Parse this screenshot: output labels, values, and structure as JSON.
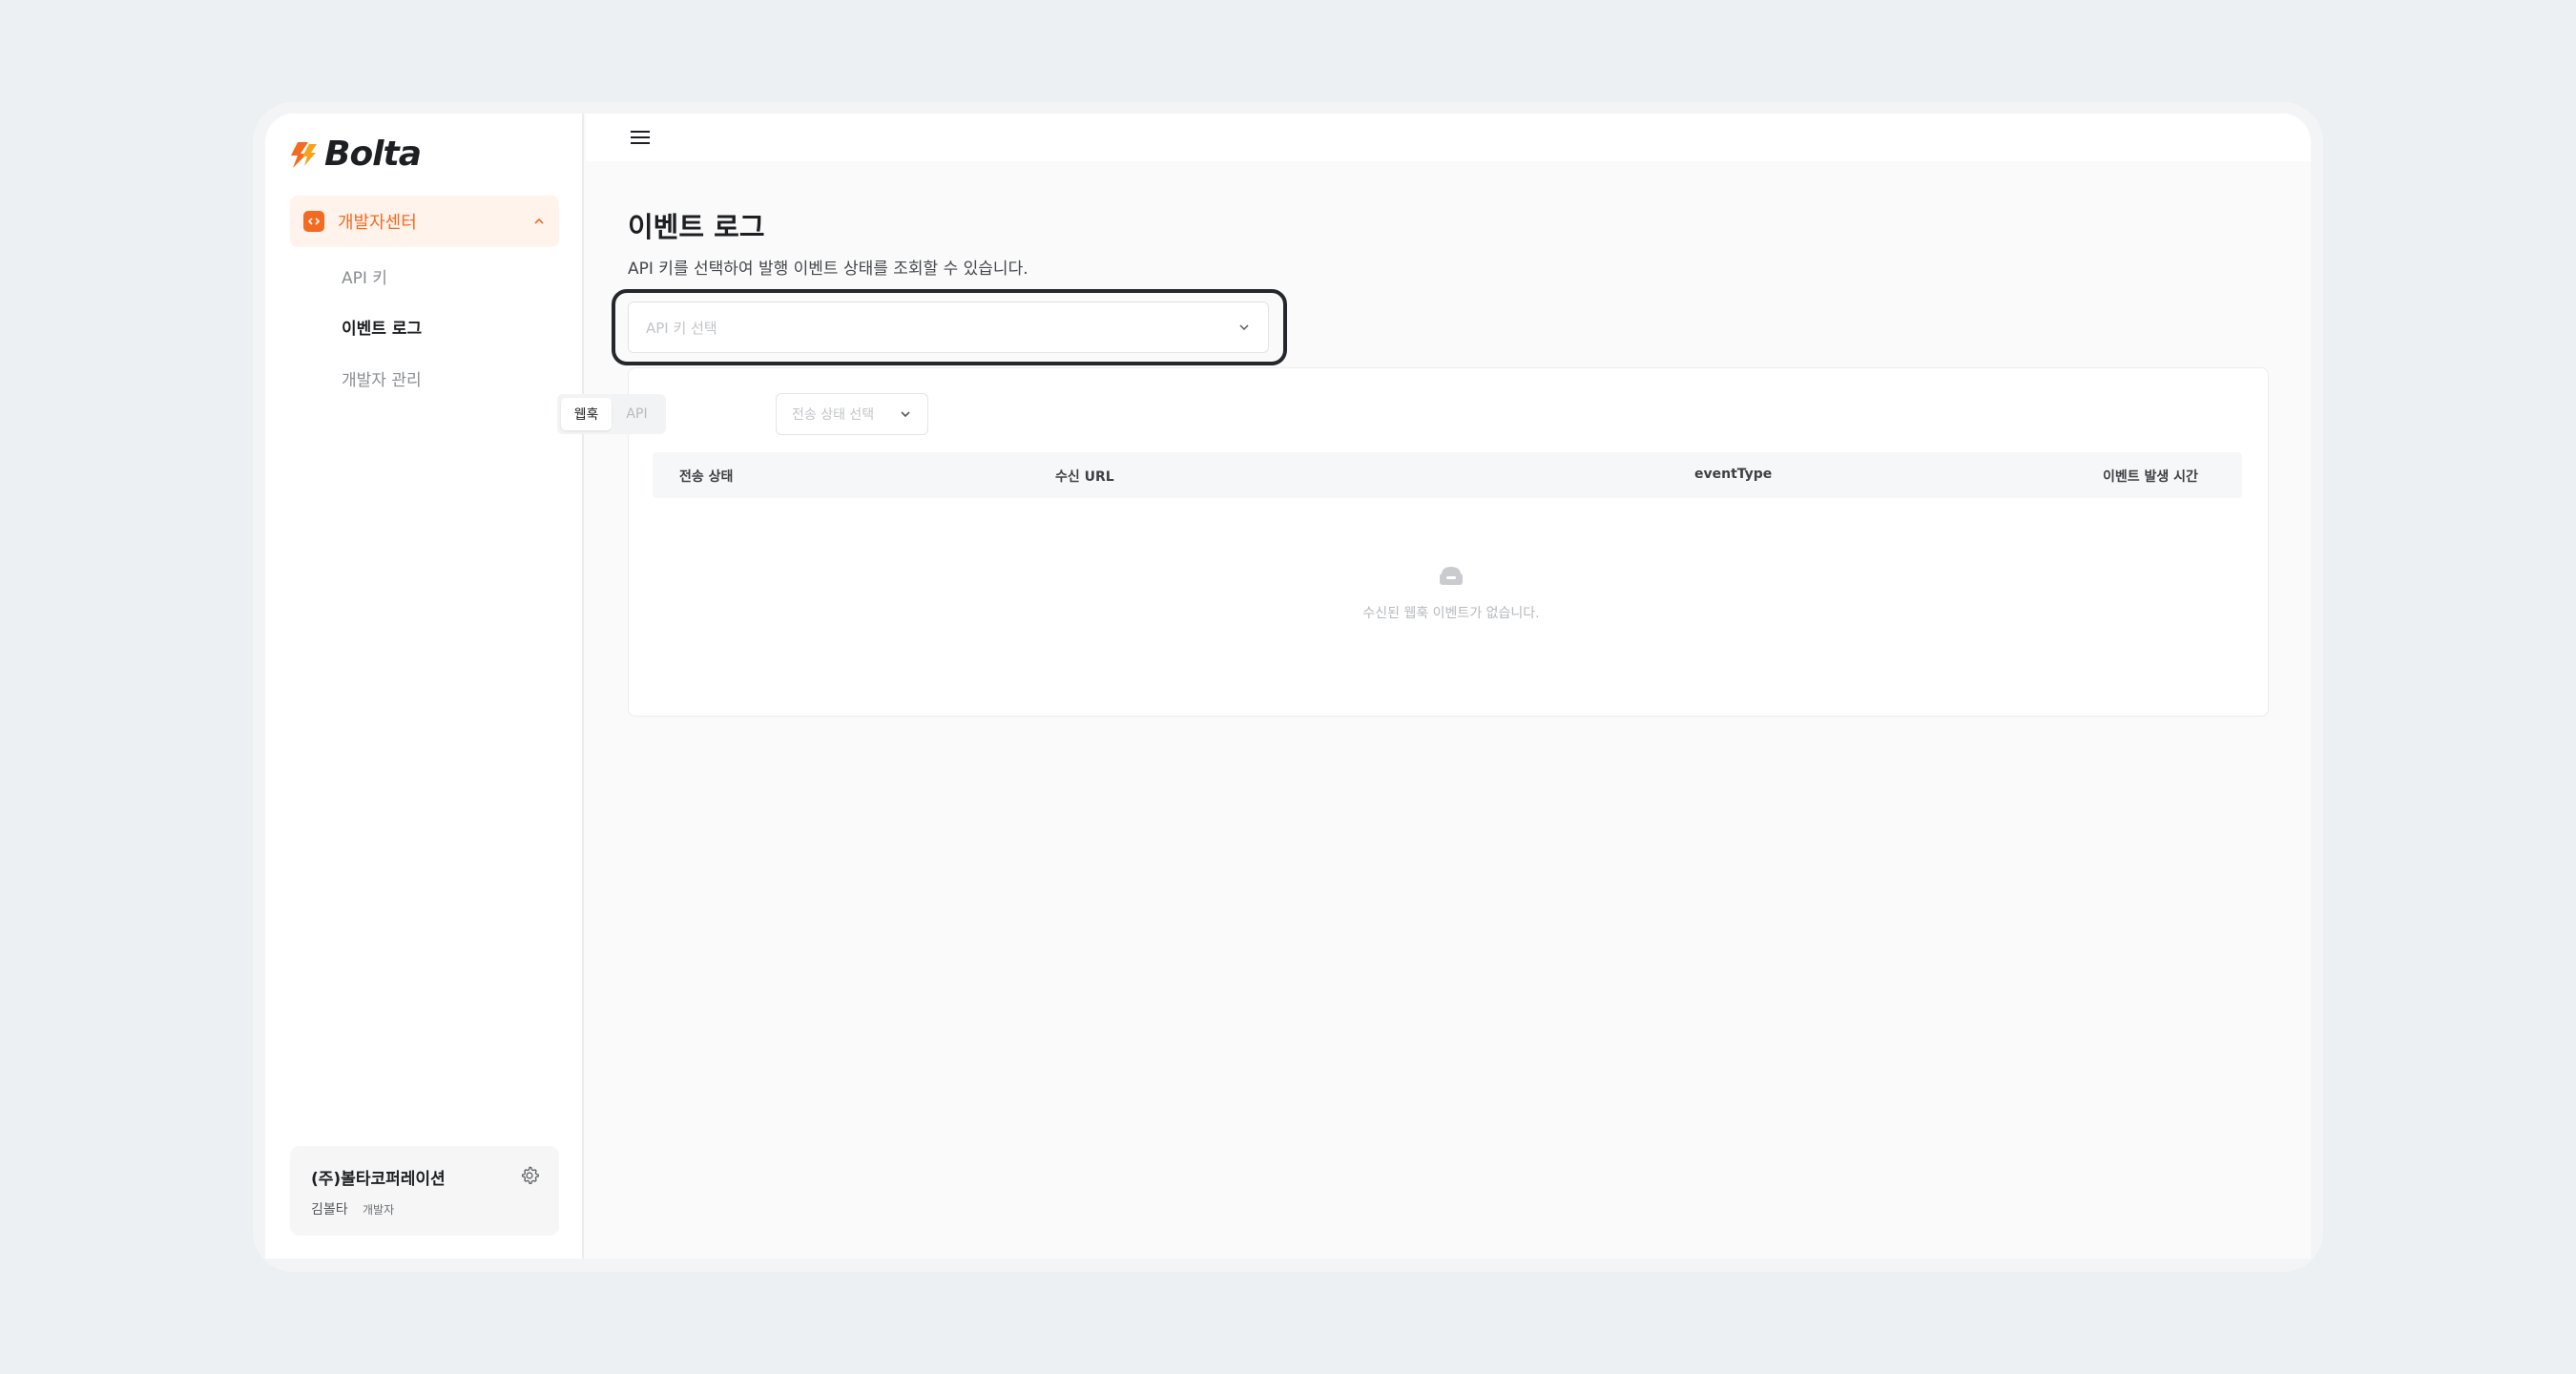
{
  "sidebar": {
    "logo_text": "Bolta",
    "group": {
      "label": "개발자센터",
      "icon": "code-icon",
      "expanded": true
    },
    "items": [
      {
        "label": "API 키",
        "active": false
      },
      {
        "label": "이벤트 로그",
        "active": true
      },
      {
        "label": "개발자 관리",
        "active": false
      }
    ],
    "org": {
      "name": "(주)볼타코퍼레이션",
      "user": "김볼타",
      "role": "개발자"
    }
  },
  "header": {
    "menu_icon": "hamburger-icon"
  },
  "main": {
    "title": "이벤트 로그",
    "description": "API 키를 선택하여 발행 이벤트 상태를 조회할 수 있습니다.",
    "key_select": {
      "placeholder": "API 키 선택"
    },
    "tabs": [
      {
        "label": "웹훅",
        "selected": true
      },
      {
        "label": "API",
        "selected": false
      }
    ],
    "status_filter": {
      "placeholder": "전송 상태 선택"
    },
    "table": {
      "columns": [
        "전송 상태",
        "수신 URL",
        "eventType",
        "이벤트 발생 시간"
      ],
      "empty_text": "수신된 웹훅 이벤트가 없습니다."
    }
  },
  "colors": {
    "accent": "#f36a21",
    "accent_bg": "#fff3ec",
    "background": "#ecf0f3",
    "text": "#1d1f22"
  }
}
